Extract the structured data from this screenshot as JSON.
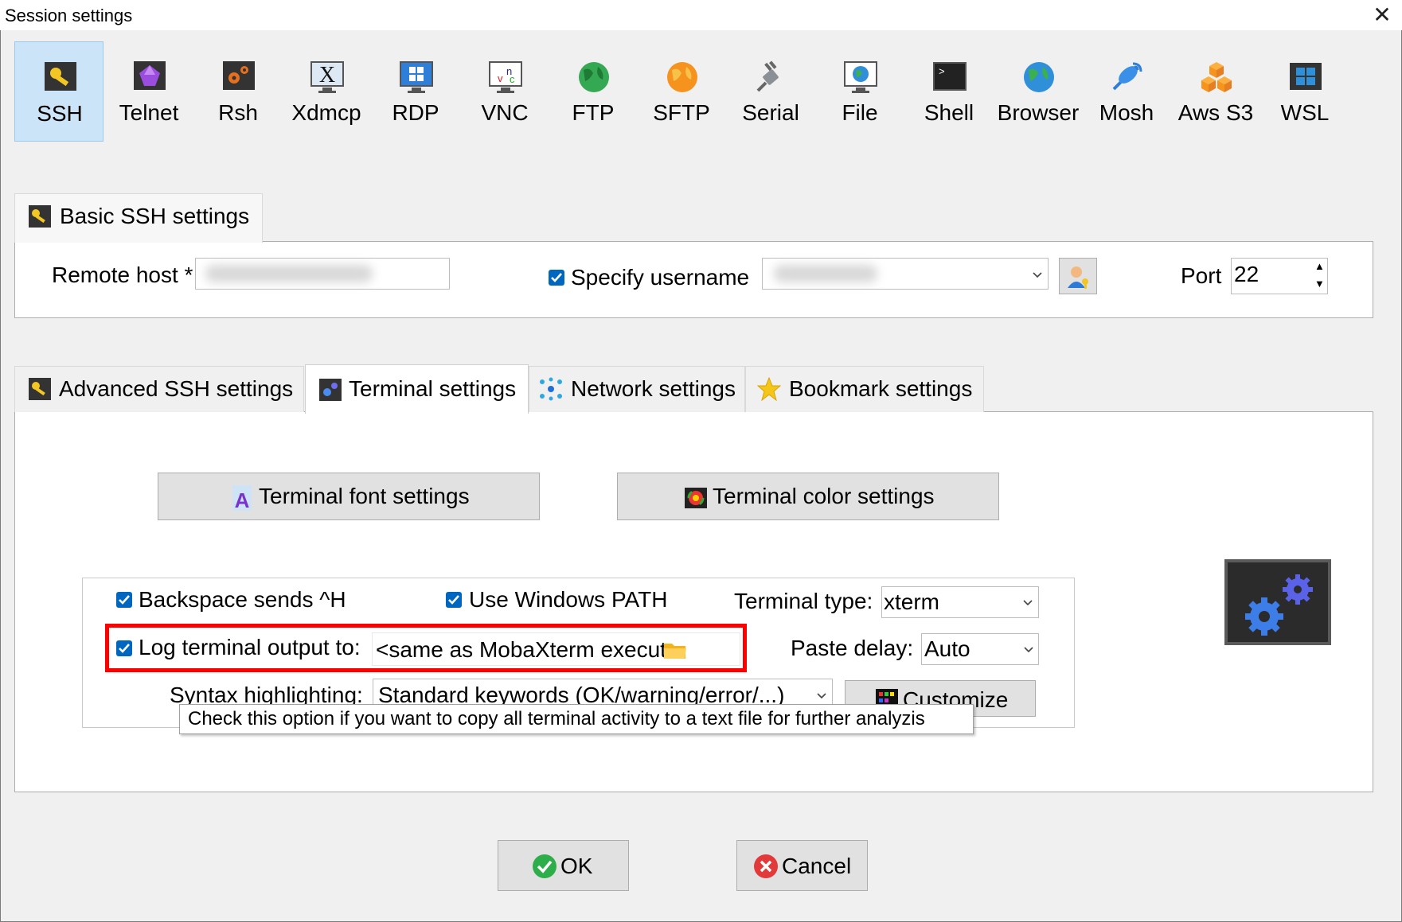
{
  "window": {
    "title": "Session settings",
    "close_glyph": "✕"
  },
  "session_types": [
    {
      "label": "SSH",
      "icon": "ssh-key-icon",
      "selected": true
    },
    {
      "label": "Telnet",
      "icon": "telnet-gem-icon"
    },
    {
      "label": "Rsh",
      "icon": "rsh-gears-icon"
    },
    {
      "label": "Xdmcp",
      "icon": "xdmcp-x-monitor-icon"
    },
    {
      "label": "RDP",
      "icon": "rdp-windows-monitor-icon"
    },
    {
      "label": "VNC",
      "icon": "vnc-monitor-icon"
    },
    {
      "label": "FTP",
      "icon": "ftp-globe-icon"
    },
    {
      "label": "SFTP",
      "icon": "sftp-globe-icon"
    },
    {
      "label": "Serial",
      "icon": "serial-plug-icon"
    },
    {
      "label": "File",
      "icon": "file-monitor-icon"
    },
    {
      "label": "Shell",
      "icon": "shell-terminal-icon"
    },
    {
      "label": "Browser",
      "icon": "browser-globe-icon"
    },
    {
      "label": "Mosh",
      "icon": "mosh-satellite-icon"
    },
    {
      "label": "Aws S3",
      "icon": "aws-s3-cubes-icon"
    },
    {
      "label": "WSL",
      "icon": "wsl-windows-icon"
    }
  ],
  "basic": {
    "tab_label": "Basic SSH settings",
    "remote_host_label": "Remote host *",
    "specify_username_label": "Specify username",
    "specify_username_checked": true,
    "port_label": "Port",
    "port_value": "22"
  },
  "tabs": [
    {
      "label": "Advanced SSH settings",
      "icon": "wrench-icon"
    },
    {
      "label": "Terminal settings",
      "icon": "terminal-gears-icon",
      "active": true
    },
    {
      "label": "Network settings",
      "icon": "network-icon"
    },
    {
      "label": "Bookmark settings",
      "icon": "star-icon"
    }
  ],
  "terminal": {
    "font_button": "Terminal font settings",
    "color_button": "Terminal color settings",
    "backspace_label": "Backspace sends ^H",
    "windows_path_label": "Use Windows PATH",
    "terminal_type_label": "Terminal type:",
    "terminal_type_value": "xterm",
    "log_label": "Log terminal output to:",
    "log_value": "<same as MobaXterm execut",
    "paste_delay_label": "Paste delay:",
    "paste_delay_value": "Auto",
    "syntax_label": "Syntax highlighting:",
    "syntax_value": "Standard keywords (OK/warning/error/...)",
    "customize_button": "Customize",
    "tooltip": "Check this option if you want to copy all terminal activity to a text file for further analyzis"
  },
  "footer": {
    "ok": "OK",
    "cancel": "Cancel"
  },
  "colors": {
    "highlight": "#ff0000",
    "accent": "#0067c0",
    "selected_bg": "#cce4f7"
  }
}
